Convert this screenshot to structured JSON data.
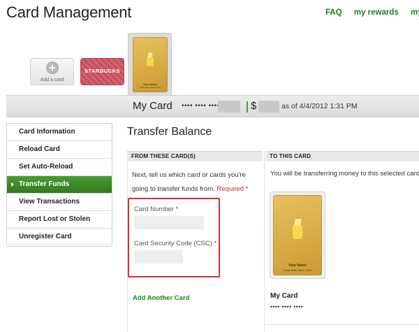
{
  "header": {
    "title": "Card Management",
    "nav": [
      "FAQ",
      "my rewards",
      "my pro"
    ]
  },
  "card_strip": {
    "add_card_label": "Add a card",
    "starbucks_logo": "STARBUCKS",
    "selected_card_name": "Your Name",
    "selected_card_sub": "Cardholder Since 2012"
  },
  "balance_bar": {
    "card_title": "My Card",
    "card_dots": "•••• •••• ••••",
    "dollar": "$",
    "as_of": "as of 4/4/2012 1:31 PM"
  },
  "sidebar": {
    "items": [
      {
        "label": "Card Information",
        "active": false
      },
      {
        "label": "Reload Card",
        "active": false
      },
      {
        "label": "Set Auto-Reload",
        "active": false
      },
      {
        "label": "Transfer Funds",
        "active": true
      },
      {
        "label": "View Transactions",
        "active": false
      },
      {
        "label": "Report Lost or Stolen",
        "active": false
      },
      {
        "label": "Unregister Card",
        "active": false
      }
    ]
  },
  "main": {
    "section_title": "Transfer Balance",
    "from_head": "FROM THESE CARD(S)",
    "to_head": "TO THIS CARD",
    "instructions": "Next, tell us which card or cards you're going to transfer funds from.",
    "required_label": "Required",
    "required_star": "*",
    "card_number_label": "Card Number",
    "card_number_value": "",
    "csc_label": "Card Security Code (CSC)",
    "csc_value": "",
    "add_another": "Add Another Card",
    "to_text": "You will be transferring money to this selected card.",
    "to_card_name": "Your Name",
    "to_card_sub": "Cardholder Since 2012",
    "my_card_label": "My Card",
    "my_card_number": "•••• •••• ••••"
  },
  "colors": {
    "accent_green": "#2f7a1f",
    "link_green": "#1f7f1f",
    "required_red": "#c9272e",
    "highlight_red": "#d63232",
    "card_gold": "#d8ac43"
  }
}
